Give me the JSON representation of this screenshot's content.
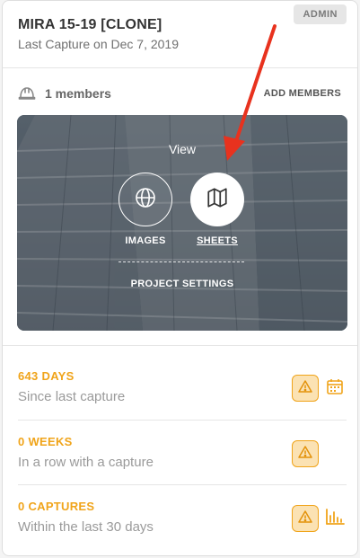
{
  "project": {
    "badge": "ADMIN",
    "title": "MIRA 15-19 [CLONE]",
    "subtitle": "Last Capture on Dec 7, 2019"
  },
  "members": {
    "count_label": "1 members",
    "add_label": "ADD MEMBERS",
    "icon": "helmet-icon"
  },
  "hero": {
    "view_label": "View",
    "images_label": "IMAGES",
    "sheets_label": "SHEETS",
    "settings_label": "PROJECT SETTINGS",
    "images_icon": "globe-icon",
    "sheets_icon": "map-icon",
    "annotation_color": "#e8321e"
  },
  "stats": [
    {
      "value": "643 DAYS",
      "desc": "Since last capture",
      "extra_icon": "calendar-icon"
    },
    {
      "value": "0 WEEKS",
      "desc": "In a row with a capture",
      "extra_icon": ""
    },
    {
      "value": "0 CAPTURES",
      "desc": "Within the last 30 days",
      "extra_icon": "bar-chart-icon"
    }
  ],
  "colors": {
    "accent": "#f0a41a",
    "warning_bg": "#fbe2b3",
    "muted_text": "#9a9a9a"
  }
}
